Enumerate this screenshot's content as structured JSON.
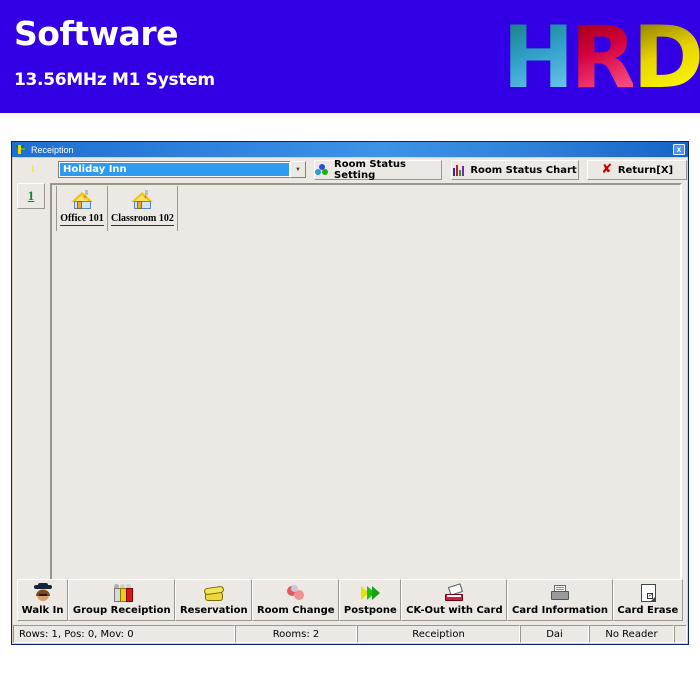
{
  "banner": {
    "title": "Software",
    "subtitle": "13.56MHz M1 System",
    "logo": {
      "h": "H",
      "r": "R",
      "d": "D"
    },
    "bg_color": "#3300e6"
  },
  "window": {
    "title": "Receiption",
    "icon": "key-icon",
    "close_label": "x"
  },
  "toolbar": {
    "marker": "1",
    "hotel_select": {
      "value": "Holiday Inn",
      "arrow": "chevron-down-icon"
    },
    "buttons": [
      {
        "label": "Room Status Setting",
        "icon": "status-dots-icon"
      },
      {
        "label": "Room Status Chart",
        "icon": "bar-chart-icon"
      },
      {
        "label": "Return[X]",
        "icon": "red-x-icon"
      }
    ]
  },
  "tabs": [
    {
      "label": "1"
    }
  ],
  "rooms": [
    {
      "label": "Office 101",
      "icon": "house-icon"
    },
    {
      "label": "Classroom 102",
      "icon": "house-icon"
    }
  ],
  "actions": [
    {
      "label": "Walk In",
      "icon": "person-hat-icon"
    },
    {
      "label": "Group Receiption",
      "icon": "group-people-icon"
    },
    {
      "label": "Reservation",
      "icon": "telephone-icon"
    },
    {
      "label": "Room Change",
      "icon": "swap-icon"
    },
    {
      "label": "Postpone",
      "icon": "double-arrow-icon"
    },
    {
      "label": "CK-Out with Card",
      "icon": "card-reader-icon"
    },
    {
      "label": "Card Information",
      "icon": "printer-icon"
    },
    {
      "label": "Card Erase",
      "icon": "page-check-icon"
    }
  ],
  "statusbar": {
    "rows": "Rows: 1, Pos: 0, Mov: 0",
    "rooms": "Rooms:  2",
    "mode": "Receiption",
    "user": "Dai",
    "reader": "No Reader",
    "pad": ""
  }
}
